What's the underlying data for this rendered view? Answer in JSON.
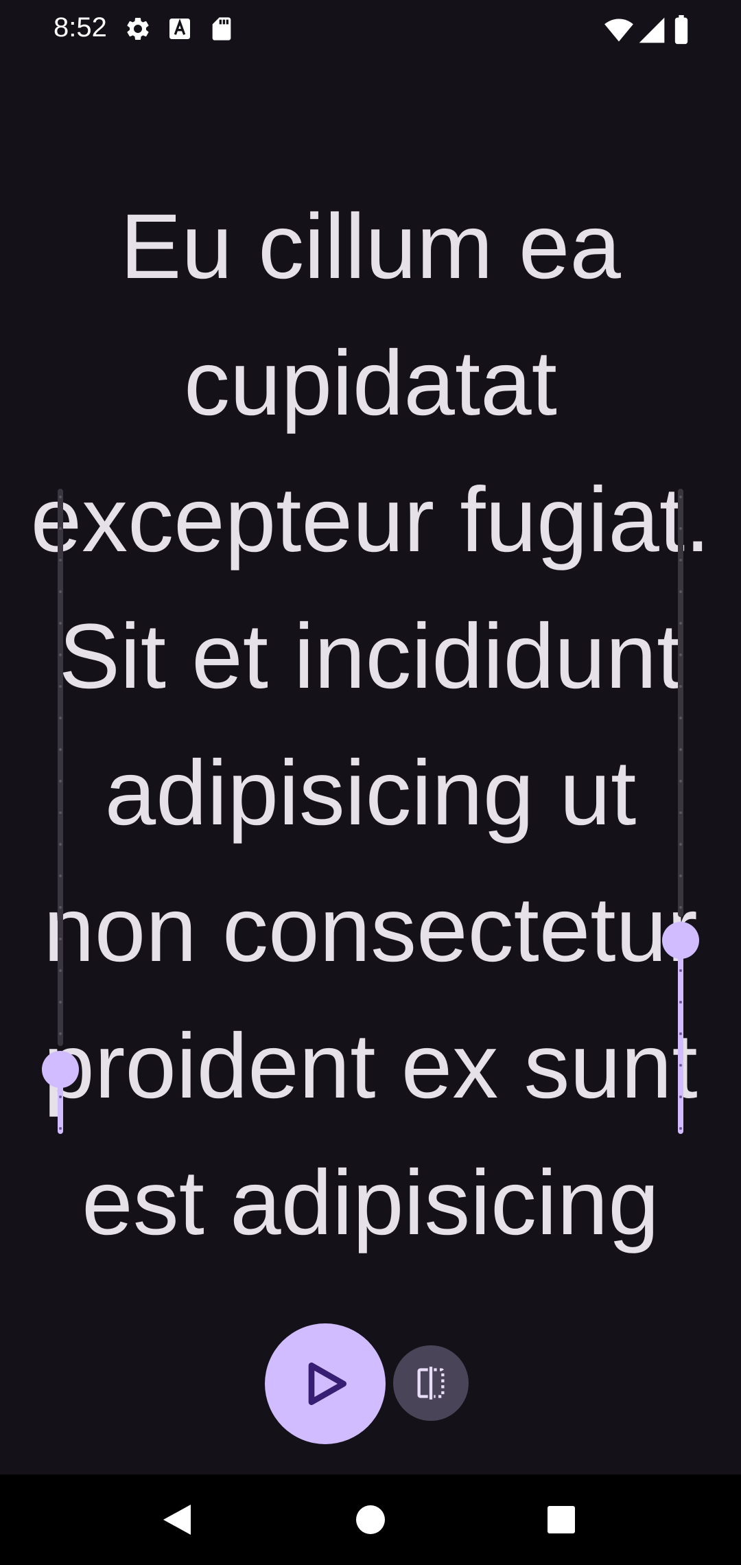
{
  "status_bar": {
    "time": "8:52",
    "left_icons": [
      "gear-icon",
      "text-a-icon",
      "sd-card-icon"
    ],
    "right_icons": [
      "wifi-icon",
      "cell-signal-icon",
      "battery-icon"
    ]
  },
  "reader": {
    "text": "Eu cillum ea cupidatat excepteur fugiat. Sit et incididunt adipisicing ut non consectetur proident ex sunt est adipisicing"
  },
  "sliders": {
    "left": {
      "value_fraction": 0.1
    },
    "right": {
      "value_fraction": 0.3
    }
  },
  "controls": {
    "play_icon": "play-icon",
    "split_icon": "split-view-icon"
  },
  "nav_bar": {
    "icons": [
      "back-icon",
      "home-icon",
      "recents-icon"
    ]
  },
  "colors": {
    "background": "#141218",
    "text": "#E6E0E9",
    "accent": "#D0BCFF",
    "on_accent": "#381E72",
    "secondary_container": "#4A4458"
  }
}
